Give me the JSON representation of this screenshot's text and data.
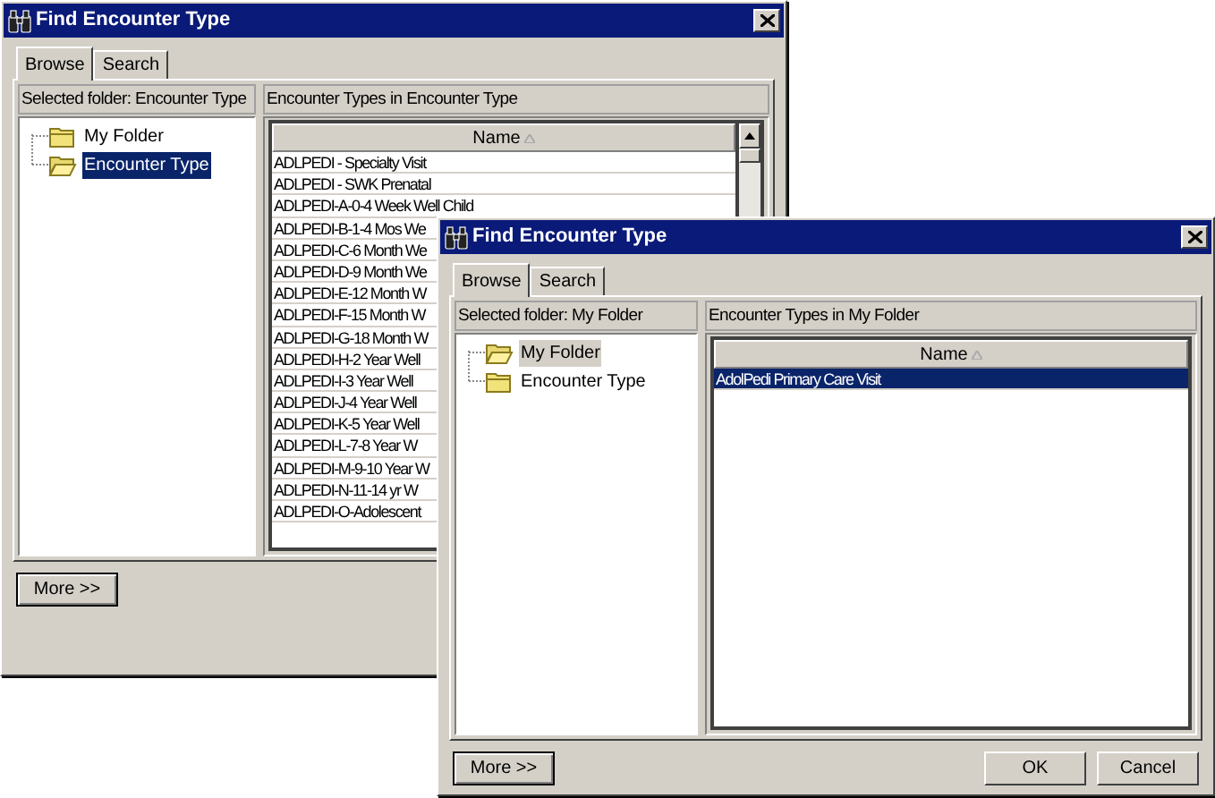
{
  "windows": [
    {
      "title": "Find Encounter Type",
      "tabs": [
        {
          "label": "Browse",
          "selected": true
        },
        {
          "label": "Search",
          "selected": false
        }
      ],
      "folder_label": "Selected folder: Encounter Type",
      "tree_focused": true,
      "tree": [
        {
          "label": "My Folder",
          "open": false,
          "selected": false
        },
        {
          "label": "Encounter Type",
          "open": true,
          "selected": true
        }
      ],
      "list_label": "Encounter Types in Encounter Type",
      "table": {
        "columns": [
          "Name"
        ],
        "rows": [
          {
            "name": "ADLPEDI - Specialty Visit",
            "selected": false
          },
          {
            "name": "ADLPEDI - SWK Prenatal",
            "selected": false
          },
          {
            "name": "ADLPEDI-A-0-4 Week Well Child",
            "selected": false
          },
          {
            "name": "ADLPEDI-B-1-4 Mos We",
            "selected": false
          },
          {
            "name": "ADLPEDI-C-6 Month We",
            "selected": false
          },
          {
            "name": "ADLPEDI-D-9 Month We",
            "selected": false
          },
          {
            "name": "ADLPEDI-E-12 Month W",
            "selected": false
          },
          {
            "name": "ADLPEDI-F-15 Month W",
            "selected": false
          },
          {
            "name": "ADLPEDI-G-18 Month W",
            "selected": false
          },
          {
            "name": "ADLPEDI-H-2 Year Well",
            "selected": false
          },
          {
            "name": "ADLPEDI-I-3 Year Well",
            "selected": false
          },
          {
            "name": "ADLPEDI-J-4 Year Well",
            "selected": false
          },
          {
            "name": "ADLPEDI-K-5 Year Well",
            "selected": false
          },
          {
            "name": "ADLPEDI-L-7-8 Year W",
            "selected": false
          },
          {
            "name": "ADLPEDI-M-9-10 Year W",
            "selected": false
          },
          {
            "name": "ADLPEDI-N-11-14 yr W",
            "selected": false
          },
          {
            "name": "ADLPEDI-O-Adolescent",
            "selected": false
          }
        ]
      },
      "buttons": [
        {
          "label": "More >>",
          "kind": "left"
        }
      ]
    },
    {
      "title": "Find Encounter Type",
      "tabs": [
        {
          "label": "Browse",
          "selected": true
        },
        {
          "label": "Search",
          "selected": false
        }
      ],
      "folder_label": "Selected folder: My Folder",
      "tree_focused": false,
      "tree": [
        {
          "label": "My Folder",
          "open": true,
          "selected": true
        },
        {
          "label": "Encounter Type",
          "open": false,
          "selected": false
        }
      ],
      "list_label": "Encounter Types in My Folder",
      "table": {
        "columns": [
          "Name"
        ],
        "rows": [
          {
            "name": "AdolPedi Primary Care Visit",
            "selected": true
          }
        ]
      },
      "buttons": [
        {
          "label": "More >>",
          "kind": "left"
        },
        {
          "label": "OK",
          "kind": "right"
        },
        {
          "label": "Cancel",
          "kind": "right"
        }
      ]
    }
  ]
}
